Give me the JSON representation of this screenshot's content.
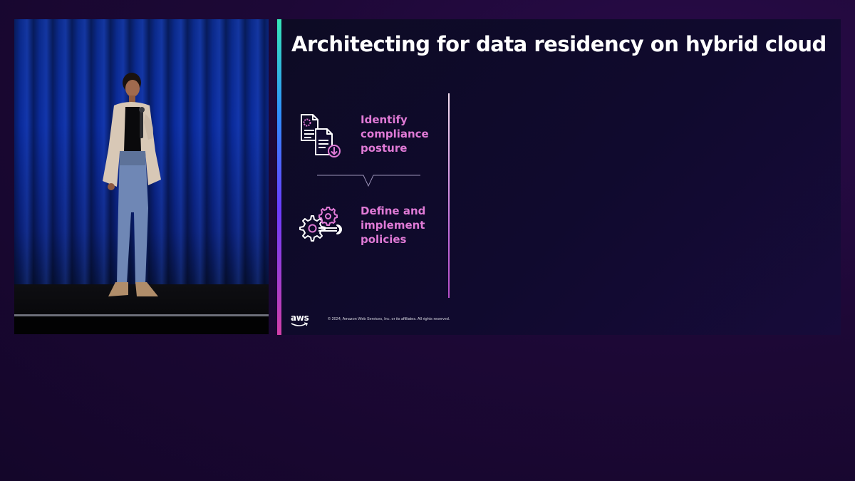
{
  "slide": {
    "title": "Architecting for data residency on hybrid cloud",
    "steps": [
      {
        "label_lines": [
          "Identify",
          "compliance",
          "posture"
        ],
        "icon": "compliance-documents-icon"
      },
      {
        "label_lines": [
          "Define and",
          "implement",
          "policies"
        ],
        "icon": "gears-wrench-icon"
      }
    ],
    "footer": {
      "logo_text": "aws",
      "copyright": "© 2024, Amazon Web Services, Inc. or its affiliates. All rights reserved."
    }
  },
  "colors": {
    "background": "#1d0836",
    "slide_background": "#100a2e",
    "accent_text": "#e07ad6",
    "title_text": "#ffffff"
  }
}
